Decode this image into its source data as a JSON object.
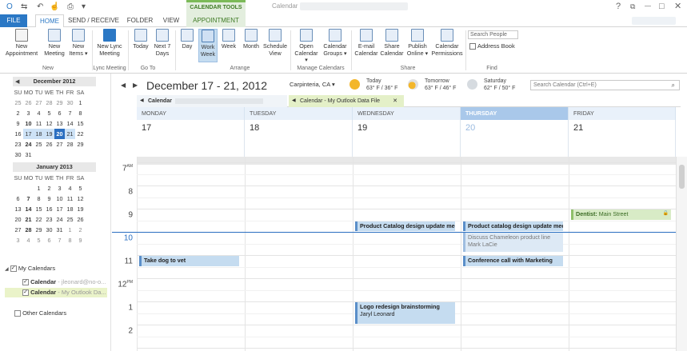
{
  "window": {
    "title": "Calendar",
    "context_tab_group": "CALENDAR TOOLS",
    "controls": {
      "help": "?",
      "restore": "⧉",
      "minimize": "—",
      "maximize": "□",
      "close": "✕"
    }
  },
  "tabs": [
    {
      "label": "FILE"
    },
    {
      "label": "HOME"
    },
    {
      "label": "SEND / RECEIVE"
    },
    {
      "label": "FOLDER"
    },
    {
      "label": "VIEW"
    },
    {
      "label": "APPOINTMENT"
    }
  ],
  "ribbon": {
    "buttons": {
      "new_appointment": "New Appointment",
      "new_meeting": "New Meeting",
      "new_items": "New Items ▾",
      "new_lync_meeting": "New Lync Meeting",
      "today": "Today",
      "next7": "Next 7 Days",
      "day": "Day",
      "work_week": "Work Week",
      "week": "Week",
      "month": "Month",
      "schedule_view": "Schedule View",
      "open_calendar": "Open Calendar ▾",
      "calendar_groups": "Calendar Groups ▾",
      "email_calendar": "E-mail Calendar",
      "share_calendar": "Share Calendar",
      "publish_online": "Publish Online ▾",
      "calendar_permissions": "Calendar Permissions"
    },
    "groups": {
      "new": "New",
      "lync": "Lync Meeting",
      "goto": "Go To",
      "arrange": "Arrange",
      "manage": "Manage Calendars",
      "share": "Share",
      "find": "Find"
    },
    "search_people_placeholder": "Search People",
    "address_book": "Address Book"
  },
  "navigation": {
    "day_headers": [
      "SU",
      "MO",
      "TU",
      "WE",
      "TH",
      "FR",
      "SA"
    ],
    "months": [
      {
        "title": "December 2012",
        "weeks": [
          [
            {
              "d": "25",
              "dim": true
            },
            {
              "d": "26",
              "dim": true
            },
            {
              "d": "27",
              "dim": true
            },
            {
              "d": "28",
              "dim": true
            },
            {
              "d": "29",
              "dim": true
            },
            {
              "d": "30",
              "dim": true
            },
            {
              "d": "1"
            }
          ],
          [
            {
              "d": "2"
            },
            {
              "d": "3"
            },
            {
              "d": "4"
            },
            {
              "d": "5"
            },
            {
              "d": "6"
            },
            {
              "d": "7"
            },
            {
              "d": "8"
            }
          ],
          [
            {
              "d": "9"
            },
            {
              "d": "10",
              "bold": true
            },
            {
              "d": "11"
            },
            {
              "d": "12"
            },
            {
              "d": "13"
            },
            {
              "d": "14"
            },
            {
              "d": "15"
            }
          ],
          [
            {
              "d": "16"
            },
            {
              "d": "17",
              "sel": true
            },
            {
              "d": "18",
              "sel": true
            },
            {
              "d": "19",
              "sel": true
            },
            {
              "d": "20",
              "today": true
            },
            {
              "d": "21",
              "sel": true
            },
            {
              "d": "22"
            }
          ],
          [
            {
              "d": "23"
            },
            {
              "d": "24",
              "bold": true
            },
            {
              "d": "25"
            },
            {
              "d": "26"
            },
            {
              "d": "27"
            },
            {
              "d": "28"
            },
            {
              "d": "29"
            }
          ],
          [
            {
              "d": "30"
            },
            {
              "d": "31"
            }
          ]
        ]
      },
      {
        "title": "January 2013",
        "weeks": [
          [
            {
              "d": ""
            },
            {
              "d": ""
            },
            {
              "d": "1"
            },
            {
              "d": "2"
            },
            {
              "d": "3"
            },
            {
              "d": "4"
            },
            {
              "d": "5"
            }
          ],
          [
            {
              "d": "6"
            },
            {
              "d": "7",
              "bold": true
            },
            {
              "d": "8"
            },
            {
              "d": "9"
            },
            {
              "d": "10"
            },
            {
              "d": "11"
            },
            {
              "d": "12"
            }
          ],
          [
            {
              "d": "13"
            },
            {
              "d": "14",
              "bold": true
            },
            {
              "d": "15"
            },
            {
              "d": "16"
            },
            {
              "d": "17"
            },
            {
              "d": "18"
            },
            {
              "d": "19"
            }
          ],
          [
            {
              "d": "20"
            },
            {
              "d": "21",
              "bold": true
            },
            {
              "d": "22"
            },
            {
              "d": "23"
            },
            {
              "d": "24"
            },
            {
              "d": "25"
            },
            {
              "d": "26"
            }
          ],
          [
            {
              "d": "27"
            },
            {
              "d": "28",
              "bold": true
            },
            {
              "d": "29"
            },
            {
              "d": "30"
            },
            {
              "d": "31"
            },
            {
              "d": "1",
              "dim": true
            },
            {
              "d": "2",
              "dim": true
            }
          ],
          [
            {
              "d": "3",
              "dim": true
            },
            {
              "d": "4",
              "dim": true
            },
            {
              "d": "5",
              "dim": true
            },
            {
              "d": "6",
              "dim": true
            },
            {
              "d": "7",
              "dim": true
            },
            {
              "d": "8",
              "dim": true
            },
            {
              "d": "9",
              "dim": true
            }
          ]
        ]
      }
    ],
    "my_calendars_label": "My Calendars",
    "calendars": [
      {
        "name": "Calendar",
        "detail": " - jleonard@no-o...",
        "checked": true
      },
      {
        "name": "Calendar",
        "detail": " - My Outlook Da...",
        "checked": true
      }
    ],
    "other_calendars_label": "Other Calendars"
  },
  "header": {
    "date_range": "December 17 - 21, 2012",
    "location": "Carpinteria, CA",
    "weather": [
      {
        "label": "Today",
        "temps": "63° F / 36° F"
      },
      {
        "label": "Tomorrow",
        "temps": "63° F / 46° F"
      },
      {
        "label": "Saturday",
        "temps": "62° F / 50° F"
      }
    ],
    "search_placeholder": "Search Calendar (Ctrl+E)"
  },
  "calendar_tabs": [
    {
      "label": "Calendar"
    },
    {
      "label": "Calendar - My Outlook Data File"
    }
  ],
  "days": [
    {
      "name": "MONDAY",
      "num": "17"
    },
    {
      "name": "TUESDAY",
      "num": "18"
    },
    {
      "name": "WEDNESDAY",
      "num": "19"
    },
    {
      "name": "THURSDAY",
      "num": "20"
    },
    {
      "name": "FRIDAY",
      "num": "21"
    }
  ],
  "hours": [
    {
      "label": "7",
      "suffix": "AM"
    },
    {
      "label": "8",
      "suffix": ""
    },
    {
      "label": "9",
      "suffix": ""
    },
    {
      "label": "10",
      "suffix": ""
    },
    {
      "label": "11",
      "suffix": ""
    },
    {
      "label": "12",
      "suffix": "PM"
    },
    {
      "label": "1",
      "suffix": ""
    },
    {
      "label": "2",
      "suffix": ""
    }
  ],
  "appointments": [
    {
      "title": "Dentist:",
      "detail": " Main Street",
      "day": 4,
      "start": 9.0,
      "end": 9.5,
      "style": "green"
    },
    {
      "title": "Product Catalog design update meet",
      "detail": "",
      "day": 2,
      "start": 9.5,
      "end": 10.0,
      "style": "blue"
    },
    {
      "title": "Product catalog design update meet",
      "detail": "",
      "day": 3,
      "start": 9.5,
      "end": 10.0,
      "style": "blue"
    },
    {
      "title": "Discuss Chameleon product line",
      "detail": "Mark LaCie",
      "day": 3,
      "start": 10.0,
      "end": 10.9,
      "style": "lblue"
    },
    {
      "title": "Take dog to vet",
      "detail": "",
      "day": 0,
      "start": 11.0,
      "end": 11.5,
      "style": "blue"
    },
    {
      "title": "Conference call with Marketing",
      "detail": "",
      "day": 3,
      "start": 11.0,
      "end": 11.5,
      "style": "blue"
    },
    {
      "title": "Logo redesign brainstorming",
      "detail": "Jaryl Leonard",
      "day": 2,
      "start": 13.0,
      "end": 14.0,
      "style": "blue"
    }
  ]
}
